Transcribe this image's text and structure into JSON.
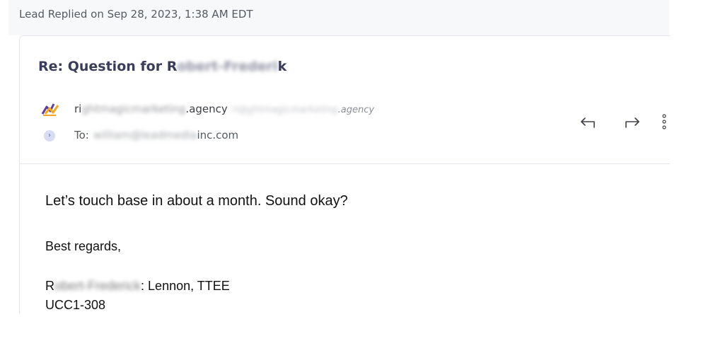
{
  "activity": {
    "header": "Lead Replied on Sep 28, 2023, 1:38 AM EDT"
  },
  "email": {
    "subject_prefix": "Re: Question for R",
    "subject_redacted": "obert-Frederi",
    "subject_suffix": "k",
    "sender": {
      "name_prefix": "ri",
      "name_redacted": "ghtmagicmarketing",
      "name_suffix": ".agency",
      "email_redacted": "ri@ghtmagicmarketing",
      "email_suffix": ".agency",
      "logo_icon": "brand-logo-icon"
    },
    "to": {
      "label": "To:",
      "address_redacted": "william@leadmedia",
      "address_suffix": "inc.com"
    },
    "actions": {
      "reply_icon": "reply-icon",
      "forward_icon": "forward-icon",
      "more_icon": "more-vertical-icon"
    },
    "body": {
      "line1": "Let’s touch base in about a month. Sound okay?",
      "line2": "Best regards,",
      "signature_prefix": "R",
      "signature_redacted": "obert-Frederick",
      "signature_suffix": ": Lennon, TTEE",
      "line4": "UCC1-308"
    }
  },
  "colors": {
    "subject": "#3a3d5a",
    "header_text": "#555a62",
    "border": "#e3e5ea",
    "band": "#f7f8fa",
    "logo_orange": "#f5a623",
    "logo_purple": "#5b3fa0"
  }
}
